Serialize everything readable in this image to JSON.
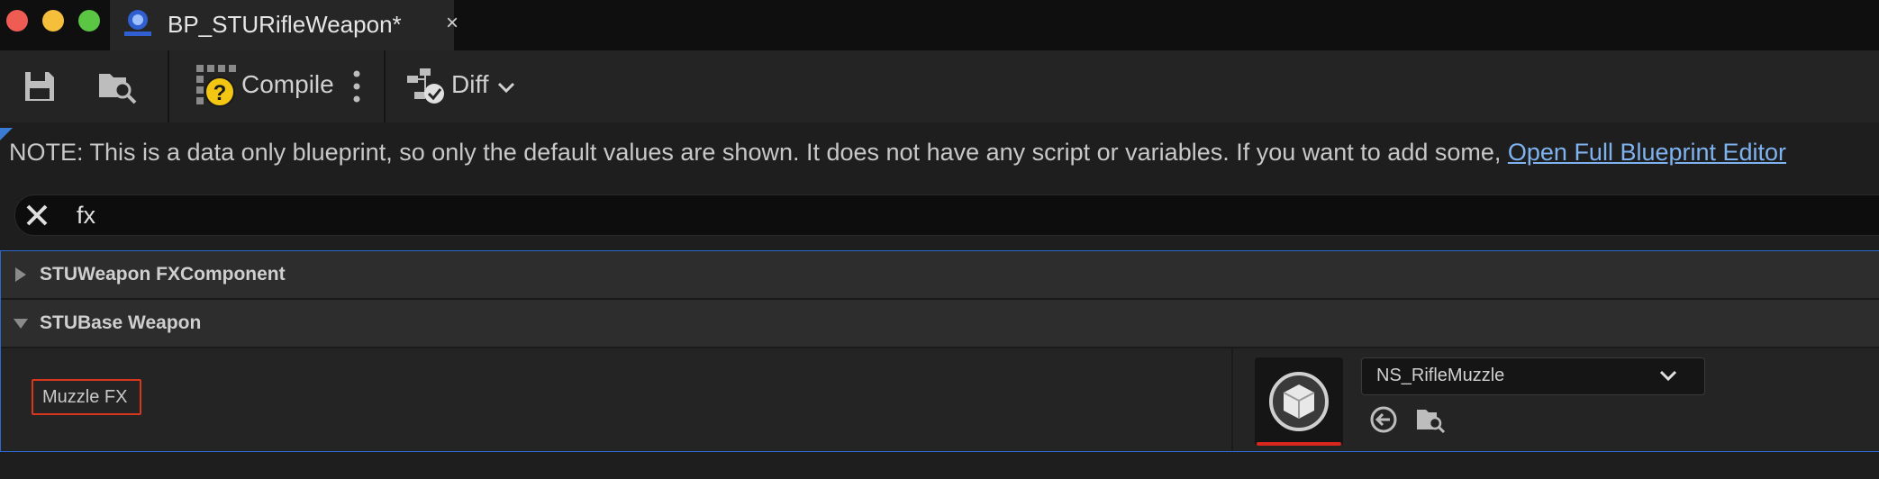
{
  "window": {
    "tab_title": "BP_STURifleWeapon*",
    "tab_close_glyph": "×"
  },
  "toolbar": {
    "save_icon": "save-icon",
    "browse_icon": "browse-folder-icon",
    "compile_label": "Compile",
    "diff_label": "Diff"
  },
  "note": {
    "text": "NOTE: This is a data only blueprint, so only the default values are shown.  It does not have any script or variables.  If you want to add some, ",
    "link": "Open Full Blueprint Editor"
  },
  "search": {
    "value": "fx"
  },
  "categories": [
    {
      "label": "STUWeapon FXComponent",
      "expanded": false
    },
    {
      "label": "STUBase Weapon",
      "expanded": true
    }
  ],
  "property": {
    "label": "Muzzle FX",
    "asset_name": "NS_RifleMuzzle"
  },
  "colors": {
    "accent_blue": "#2a6ad0",
    "link": "#7fb3f0",
    "highlight_red": "#d9361e"
  }
}
